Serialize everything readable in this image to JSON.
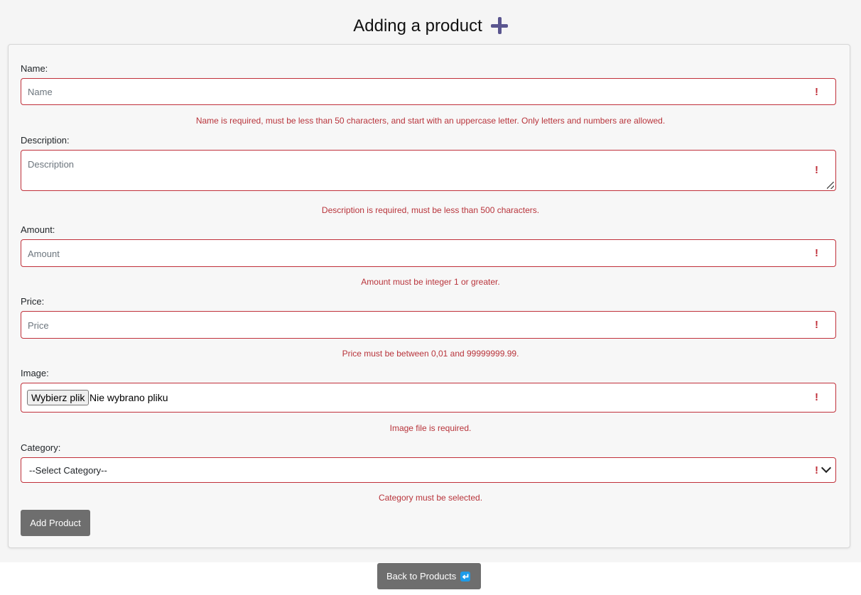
{
  "page": {
    "title": "Adding a product",
    "title_icon": "plus-icon"
  },
  "form": {
    "name": {
      "label": "Name:",
      "placeholder": "Name",
      "error": "Name is required, must be less than 50 characters, and start with an uppercase letter. Only letters and numbers are allowed."
    },
    "description": {
      "label": "Description:",
      "placeholder": "Description",
      "error": "Description is required, must be less than 500 characters."
    },
    "amount": {
      "label": "Amount:",
      "placeholder": "Amount",
      "error": "Amount must be integer 1 or greater."
    },
    "price": {
      "label": "Price:",
      "placeholder": "Price",
      "error": "Price must be between 0,01 and 99999999.99."
    },
    "image": {
      "label": "Image:",
      "button_label": "Wybierz plik",
      "status": "Nie wybrano pliku",
      "error": "Image file is required."
    },
    "category": {
      "label": "Category:",
      "selected": "--Select Category--",
      "error": "Category must be selected."
    },
    "error_marker": "!",
    "submit_label": "Add Product"
  },
  "footer": {
    "back_label": "Back to Products",
    "back_icon": "return-icon"
  },
  "colors": {
    "error": "#c0303a",
    "button": "#6e6e6e",
    "accent_icon": "#5a558f",
    "return_icon": "#1e9be8"
  }
}
